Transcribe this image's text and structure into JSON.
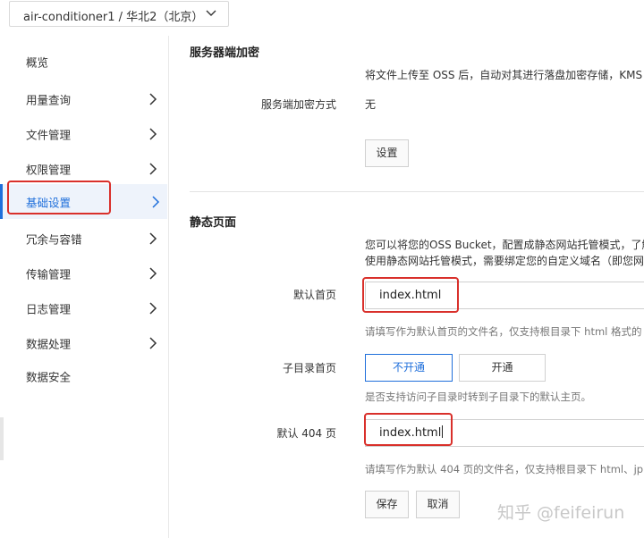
{
  "bucket_selector": {
    "label": "air-conditioner1 / 华北2（北京）"
  },
  "sidebar": {
    "items": [
      {
        "label": "概览",
        "arrow": false
      },
      {
        "label": "用量查询",
        "arrow": true
      },
      {
        "label": "文件管理",
        "arrow": true
      },
      {
        "label": "权限管理",
        "arrow": true
      },
      {
        "label": "基础设置",
        "arrow": true,
        "active": true
      },
      {
        "label": "冗余与容错",
        "arrow": true
      },
      {
        "label": "传输管理",
        "arrow": true
      },
      {
        "label": "日志管理",
        "arrow": true
      },
      {
        "label": "数据处理",
        "arrow": true
      },
      {
        "label": "数据安全",
        "arrow": false
      }
    ]
  },
  "encryption": {
    "title": "服务器端加密",
    "description": "将文件上传至 OSS 后，自动对其进行落盘加密存储，KMS 加",
    "method_label": "服务端加密方式",
    "method_value": "无",
    "settings_button": "设置"
  },
  "static_page": {
    "title": "静态页面",
    "desc_line1": "您可以将您的OSS Bucket，配置成静态网站托管模式，了解",
    "desc_line2": "使用静态网站托管模式，需要绑定您的自定义域名（即您网站",
    "default_index_label": "默认首页",
    "default_index_value": "index.html",
    "default_index_hint": "请填写作为默认首页的文件名，仅支持根目录下 html 格式的",
    "subdir_label": "子目录首页",
    "subdir_off": "不开通",
    "subdir_on": "开通",
    "subdir_hint": "是否支持访问子目录时转到子目录下的默认主页。",
    "default_404_label": "默认 404 页",
    "default_404_value": "index.html",
    "default_404_hint": "请填写作为默认 404 页的文件名，仅支持根目录下 html、jp",
    "save_button": "保存",
    "cancel_button": "取消"
  },
  "watermark": "知乎 @feifeirun",
  "colors": {
    "accent": "#1f6fdb",
    "highlight": "#d9302b"
  }
}
